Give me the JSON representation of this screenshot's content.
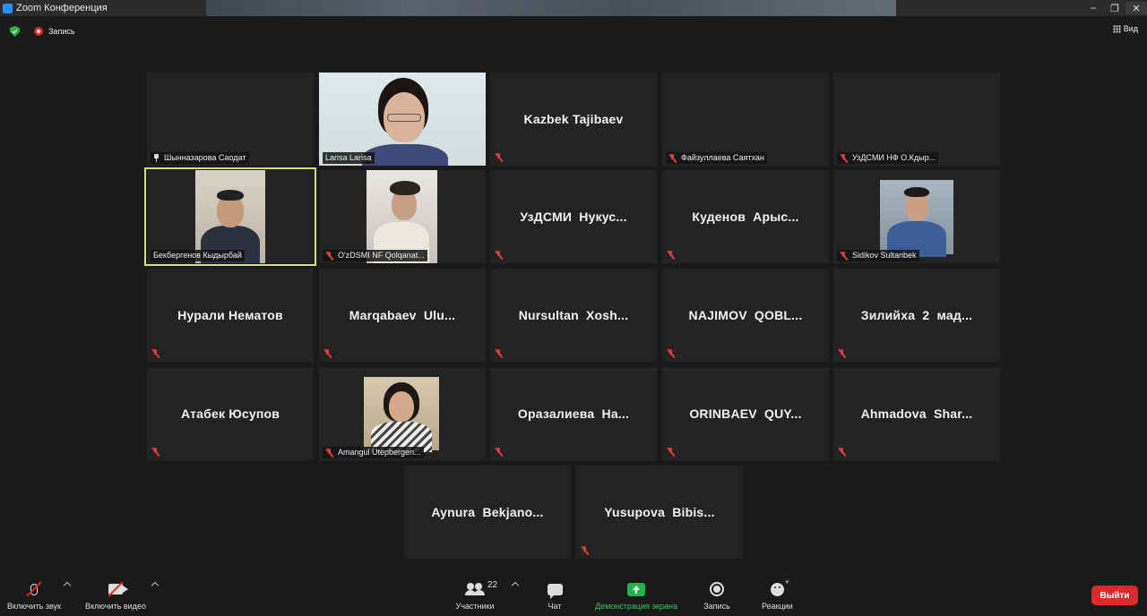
{
  "window": {
    "title": "Zoom Конференция"
  },
  "topbar": {
    "recording_label": "Запись",
    "view_label": "Вид"
  },
  "tiles": [
    {
      "type": "label",
      "big": "",
      "label": "Шынназарова Саодат",
      "pinned": true,
      "muted": false
    },
    {
      "type": "video",
      "big": "",
      "label": "Larisa Larisa",
      "pinned": false,
      "muted": false
    },
    {
      "type": "name",
      "big": "Kazbek Tajibaev",
      "label": "",
      "pinned": false,
      "muted": true
    },
    {
      "type": "label",
      "big": "",
      "label": "Файзуллаева Саятхан",
      "pinned": false,
      "muted": true
    },
    {
      "type": "label",
      "big": "",
      "label": "УзДСМИ НФ О.Кдыр...",
      "pinned": false,
      "muted": true
    },
    {
      "type": "video",
      "big": "",
      "label": "Бекбергенов Кыдырбай",
      "pinned": false,
      "muted": false,
      "active": true
    },
    {
      "type": "video",
      "big": "",
      "label": "O'zDSMI NF Qolqanat...",
      "pinned": false,
      "muted": true
    },
    {
      "type": "name",
      "big": "УзДСМИ  Нукус...",
      "label": "",
      "pinned": false,
      "muted": true
    },
    {
      "type": "name",
      "big": "Куденов  Арыс...",
      "label": "",
      "pinned": false,
      "muted": true
    },
    {
      "type": "video",
      "big": "",
      "label": "Sidikov Sultanbek",
      "pinned": false,
      "muted": true
    },
    {
      "type": "name",
      "big": "Нурали Нематов",
      "label": "",
      "pinned": false,
      "muted": true
    },
    {
      "type": "name",
      "big": "Marqabaev  Ulu...",
      "label": "",
      "pinned": false,
      "muted": true
    },
    {
      "type": "name",
      "big": "Nursultan  Xosh...",
      "label": "",
      "pinned": false,
      "muted": true
    },
    {
      "type": "name",
      "big": "NAJIMOV  QOBL...",
      "label": "",
      "pinned": false,
      "muted": true
    },
    {
      "type": "name",
      "big": "Зилийха  2  мад...",
      "label": "",
      "pinned": false,
      "muted": true
    },
    {
      "type": "name",
      "big": "Атабек Юсупов",
      "label": "",
      "pinned": false,
      "muted": true
    },
    {
      "type": "video",
      "big": "",
      "label": "Amangul Utepbergen...",
      "pinned": false,
      "muted": true
    },
    {
      "type": "name",
      "big": "Оразалиева  На...",
      "label": "",
      "pinned": false,
      "muted": true
    },
    {
      "type": "name",
      "big": "ORINBAEV  QUY...",
      "label": "",
      "pinned": false,
      "muted": true
    },
    {
      "type": "name",
      "big": "Ahmadova  Shar...",
      "label": "",
      "pinned": false,
      "muted": true
    },
    {
      "type": "name",
      "big": "Aynura  Bekjano...",
      "label": "",
      "pinned": false,
      "muted": false
    },
    {
      "type": "name",
      "big": "Yusupova  Bibis...",
      "label": "",
      "pinned": false,
      "muted": true
    }
  ],
  "toolbar": {
    "audio_label": "Включить звук",
    "video_label": "Включить видео",
    "participants_label": "Участники",
    "participants_count": "22",
    "chat_label": "Чат",
    "share_label": "Демонстрация экрана",
    "record_label": "Запись",
    "reactions_label": "Реакции",
    "leave_label": "Выйти"
  },
  "colors": {
    "accent_active": "#d5e27a",
    "share_green": "#24b24a",
    "leave_red": "#d82c2c",
    "muted_red": "#e23d3d"
  },
  "icons": [
    "zoom-app-icon",
    "shield-icon",
    "record-icon",
    "grid-icon",
    "pin-icon",
    "mic-muted-icon",
    "camera-off-icon",
    "participants-icon",
    "chat-icon",
    "share-screen-icon",
    "record-button-icon",
    "reactions-icon"
  ]
}
